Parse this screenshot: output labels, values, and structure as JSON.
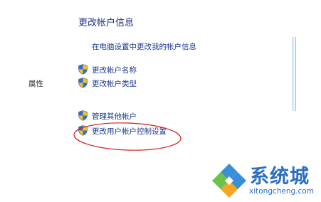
{
  "section": {
    "title": "更改帐户信息"
  },
  "links": {
    "pc_settings": "在电脑设置中更改我的帐户信息",
    "change_name": "更改帐户名称",
    "change_type": "更改帐户类型",
    "manage_other": "管理其他帐户",
    "uac_settings": "更改用户帐户控制设置"
  },
  "sidebar": {
    "partial_label": "属性"
  },
  "watermark": {
    "brand": "系统城",
    "url": "xitongcheng.com"
  },
  "colors": {
    "link": "#1a3a8f",
    "title": "#1e3287",
    "highlight_ellipse": "#d42020",
    "brand": "#2a6fc0"
  },
  "icons": {
    "shield": "uac-shield-icon"
  }
}
